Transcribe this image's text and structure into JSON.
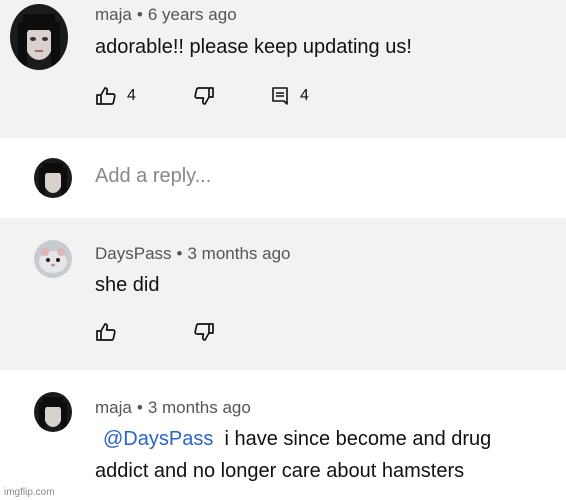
{
  "comments": [
    {
      "author": "maja",
      "time": "6 years ago",
      "text": "adorable!! please keep updating us!",
      "likes": "4",
      "replies": "4",
      "avatar": "woman-portrait-avatar"
    },
    {
      "author": "DaysPass",
      "time": "3 months ago",
      "text": "she did",
      "avatar": "hamster-avatar"
    },
    {
      "author": "maja",
      "time": "3 months ago",
      "mention": "@DaysPass",
      "text_line1": "i have since become and drug",
      "text_line2": "addict and no longer care about hamsters",
      "avatar": "woman-portrait-avatar"
    }
  ],
  "reply": {
    "placeholder": "Add a reply..."
  },
  "separator": "•",
  "watermark": "imgflip.com",
  "icons": {
    "like": "thumbs-up-icon",
    "dislike": "thumbs-down-icon",
    "reply": "reply-comment-icon"
  },
  "colors": {
    "mention": "#2a63c7",
    "meta": "#555555",
    "placeholder": "#888888"
  }
}
